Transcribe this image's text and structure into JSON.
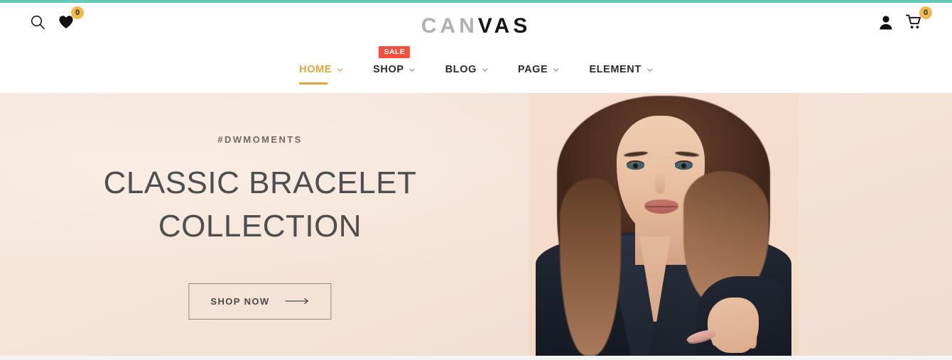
{
  "theme": {
    "accent_bar_color": "#63c9b6",
    "brand_orange": "#e0a53a",
    "badge_amber": "#f0b94c",
    "sale_red": "#f4503c",
    "hero_bg": "#f6e5d9",
    "heading_gray": "#4e4e4e"
  },
  "header": {
    "search_icon": "search-icon",
    "wishlist_icon": "heart-icon",
    "wishlist_count": "0",
    "account_icon": "user-icon",
    "cart_icon": "shopping-cart-icon",
    "cart_count": "0",
    "logo": {
      "part_one": "CAN",
      "part_two": "VAS",
      "full": "CANVAS"
    }
  },
  "nav": {
    "items": [
      {
        "label": "HOME",
        "active": true,
        "has_dropdown": true,
        "badge": null
      },
      {
        "label": "SHOP",
        "active": false,
        "has_dropdown": true,
        "badge": "SALE"
      },
      {
        "label": "BLOG",
        "active": false,
        "has_dropdown": true,
        "badge": null
      },
      {
        "label": "PAGE",
        "active": false,
        "has_dropdown": true,
        "badge": null
      },
      {
        "label": "ELEMENT",
        "active": false,
        "has_dropdown": true,
        "badge": null
      }
    ]
  },
  "hero": {
    "eyebrow": "#DWMOMENTS",
    "title_line_1": "CLASSIC BRACELET",
    "title_line_2": "COLLECTION",
    "cta_label": "SHOP NOW",
    "cta_arrow_icon": "arrow-right-icon",
    "image_alt": "fashion-model-wearing-bracelet"
  }
}
